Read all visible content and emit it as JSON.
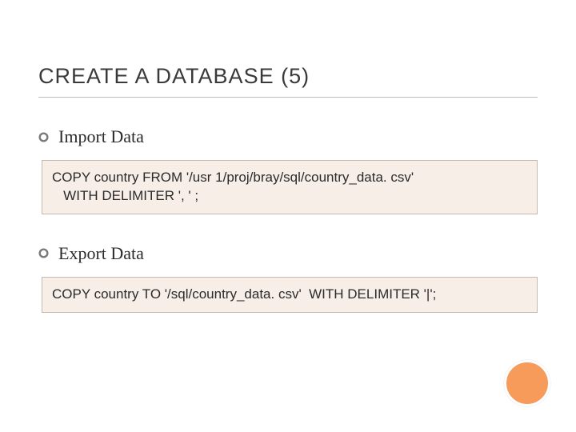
{
  "title": "CREATE A DATABASE (5)",
  "sections": [
    {
      "heading": "Import Data",
      "code": "COPY country FROM '/usr 1/proj/bray/sql/country_data. csv'\n   WITH DELIMITER ', ' ;"
    },
    {
      "heading": "Export Data",
      "code": "COPY country TO '/sql/country_data. csv'  WITH DELIMITER '|';"
    }
  ],
  "accent_color": "#f79b5a"
}
